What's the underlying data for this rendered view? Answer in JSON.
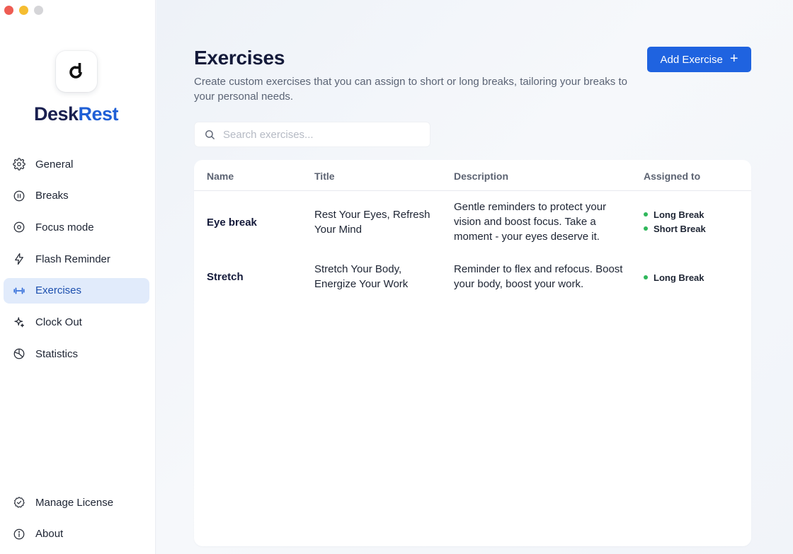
{
  "app": {
    "brand_part1": "Desk",
    "brand_part2": "Rest",
    "accent_color": "#1f63e0",
    "active_bg": "#e1ebfb"
  },
  "sidebar": {
    "items": [
      {
        "label": "General",
        "icon": "gear-icon"
      },
      {
        "label": "Breaks",
        "icon": "pause-circle-icon"
      },
      {
        "label": "Focus mode",
        "icon": "focus-target-icon"
      },
      {
        "label": "Flash Reminder",
        "icon": "lightning-bolt-icon"
      },
      {
        "label": "Exercises",
        "icon": "dumbbell-icon",
        "active": true
      },
      {
        "label": "Clock Out",
        "icon": "sparkle-icon"
      },
      {
        "label": "Statistics",
        "icon": "pie-chart-icon"
      }
    ],
    "bottom_items": [
      {
        "label": "Manage License",
        "icon": "badge-check-icon"
      },
      {
        "label": "About",
        "icon": "info-icon"
      }
    ]
  },
  "main": {
    "title": "Exercises",
    "description": "Create custom exercises that you can assign to short or long breaks, tailoring your breaks to your personal needs.",
    "add_button_label": "Add Exercise",
    "search": {
      "placeholder": "Search exercises...",
      "value": ""
    },
    "table": {
      "columns": [
        "Name",
        "Title",
        "Description",
        "Assigned to"
      ],
      "rows": [
        {
          "name": "Eye break",
          "title": "Rest Your Eyes, Refresh Your Mind",
          "description": "Gentle reminders to protect your vision and boost focus. Take a moment - your eyes deserve it.",
          "assigned": [
            "Long Break",
            "Short Break"
          ]
        },
        {
          "name": "Stretch",
          "title": "Stretch Your Body, Energize Your Work",
          "description": "Reminder to flex and refocus. Boost your body, boost your work.",
          "assigned": [
            "Long Break"
          ]
        }
      ]
    },
    "status_dot_color": "#2fb75b"
  }
}
